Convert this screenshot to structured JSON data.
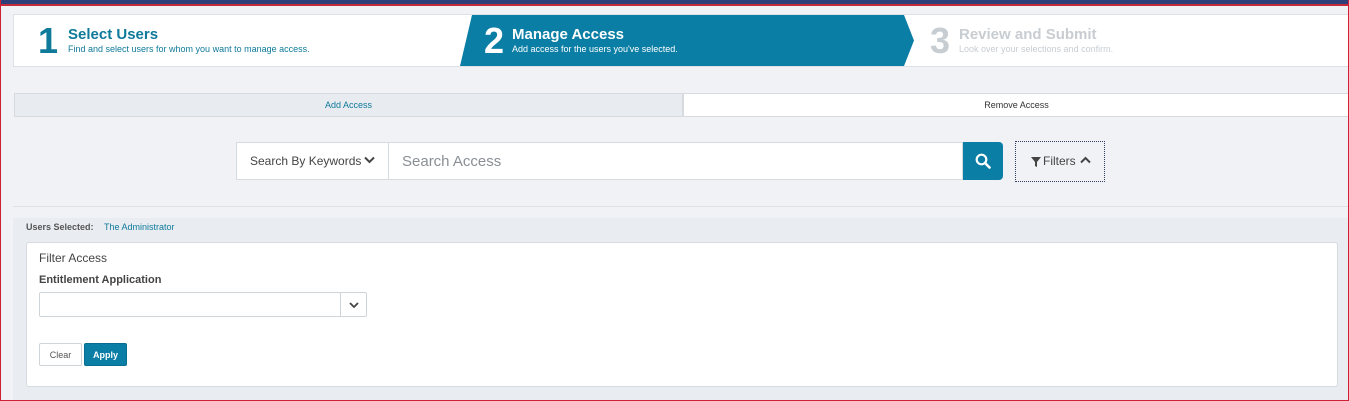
{
  "wizard": {
    "steps": [
      {
        "number": "1",
        "title": "Select Users",
        "subtitle": "Find and select users for whom you want to manage access."
      },
      {
        "number": "2",
        "title": "Manage Access",
        "subtitle": "Add access for the users you've selected."
      },
      {
        "number": "3",
        "title": "Review and Submit",
        "subtitle": "Look over your selections and confirm."
      }
    ],
    "active_step": 2
  },
  "tabs": [
    {
      "label": "Add Access",
      "active": true
    },
    {
      "label": "Remove Access",
      "active": false
    }
  ],
  "search": {
    "mode_label": "Search By Keywords",
    "placeholder": "Search Access",
    "value": "",
    "filters_label": "Filters"
  },
  "users_selected": {
    "label": "Users Selected:",
    "name": "The Administrator"
  },
  "filter_panel": {
    "title": "Filter Access",
    "field_label": "Entitlement Application",
    "field_value": "",
    "clear_label": "Clear",
    "apply_label": "Apply"
  },
  "colors": {
    "accent": "#0a7ea4",
    "inactive_step": "#c8cdd2",
    "top_bar": "#2f3f7a",
    "border_red": "#c42b3a"
  }
}
